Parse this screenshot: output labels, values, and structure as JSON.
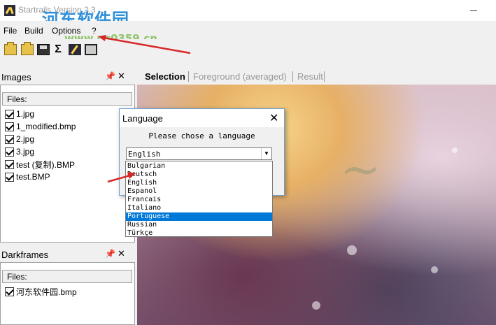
{
  "window": {
    "title": "Startrails Version 2.3"
  },
  "watermark": {
    "text": "河东软件园",
    "url": "www.pc0359.cn"
  },
  "menu": [
    "File",
    "Build",
    "Options",
    "?"
  ],
  "toolbar": {
    "buttons": [
      "open-folder-icon",
      "open-files-icon",
      "save-icon",
      "sum-icon",
      "star-trails-icon",
      "film-icon"
    ]
  },
  "images_panel": {
    "title": "Images",
    "files_label": "Files:",
    "files": [
      "1.jpg",
      "1_modified.bmp",
      "2.jpg",
      "3.jpg",
      "test (复制).BMP",
      "test.BMP"
    ]
  },
  "darkframes_panel": {
    "title": "Darkframes",
    "files_label": "Files:",
    "files": [
      "河东软件园.bmp"
    ]
  },
  "tabs": [
    "Selection",
    "Foreground (averaged)",
    "Result"
  ],
  "dialog": {
    "title": "Language",
    "prompt": "Please chose a language",
    "selected": "English",
    "options": [
      "Bulgarian",
      "Deutsch",
      "English",
      "Espanol",
      "Francais",
      "Italiano",
      "Portuguese",
      "Russian",
      "Türkçe"
    ],
    "highlighted_option": "Portuguese"
  },
  "colors": {
    "accent": "#0078d7",
    "arrow": "#d62828",
    "watermark": "#2f8fd9"
  }
}
